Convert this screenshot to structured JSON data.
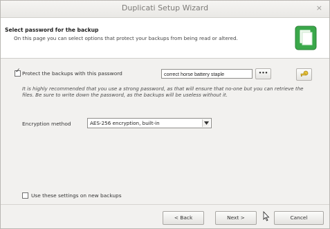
{
  "window": {
    "title": "Duplicati Setup Wizard",
    "close_symbol": "×"
  },
  "header": {
    "title": "Select password for the backup",
    "description": "On this page you can select options that protect your backups from being read or altered."
  },
  "protect": {
    "checked": true,
    "check_symbol": "✓",
    "label": "Protect the backups with this password",
    "password_value": "correct horse battery staple",
    "reveal_button_label": "•••"
  },
  "warning_text": "It is highly recommended that you use a strong password, as that will ensure that no-one but you can retrieve the files. Be sure to write down the password, as the backups will be useless without it.",
  "encryption": {
    "label": "Encryption method",
    "selected": "AES-256 encryption, built-in"
  },
  "use_settings": {
    "checked": false,
    "label": "Use these settings on new backups"
  },
  "buttons": {
    "back": "< Back",
    "next": "Next >",
    "cancel": "Cancel"
  },
  "colors": {
    "header_bg": "#ffffff",
    "window_bg": "#f2f1ef",
    "icon_green": "#3aa84a"
  },
  "icons": {
    "wizard": "document-green-icon",
    "generate": "key-icon",
    "dropdown": "chevron-down-icon",
    "cursor": "mouse-pointer-icon"
  }
}
